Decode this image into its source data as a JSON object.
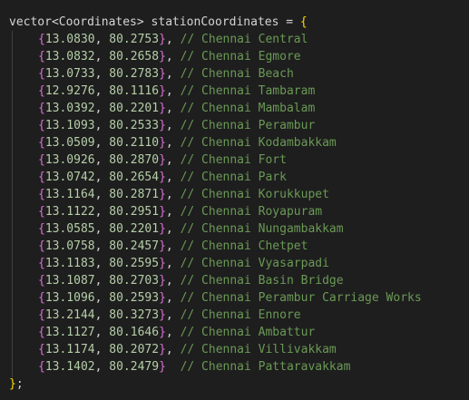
{
  "code": {
    "declaration": {
      "type_text": "vector<Coordinates>",
      "var_text": "stationCoordinates",
      "op_text": " = ",
      "open_brace": "{"
    },
    "entries": [
      {
        "lat": "13.0830",
        "lon": "80.2753",
        "sep": ",",
        "comment": "// Chennai Central"
      },
      {
        "lat": "13.0832",
        "lon": "80.2658",
        "sep": ",",
        "comment": "// Chennai Egmore"
      },
      {
        "lat": "13.0733",
        "lon": "80.2783",
        "sep": ",",
        "comment": "// Chennai Beach"
      },
      {
        "lat": "12.9276",
        "lon": "80.1116",
        "sep": ",",
        "comment": "// Chennai Tambaram"
      },
      {
        "lat": "13.0392",
        "lon": "80.2201",
        "sep": ",",
        "comment": "// Chennai Mambalam"
      },
      {
        "lat": "13.1093",
        "lon": "80.2533",
        "sep": ",",
        "comment": "// Chennai Perambur"
      },
      {
        "lat": "13.0509",
        "lon": "80.2110",
        "sep": ",",
        "comment": "// Chennai Kodambakkam"
      },
      {
        "lat": "13.0926",
        "lon": "80.2870",
        "sep": ",",
        "comment": "// Chennai Fort"
      },
      {
        "lat": "13.0742",
        "lon": "80.2654",
        "sep": ",",
        "comment": "// Chennai Park"
      },
      {
        "lat": "13.1164",
        "lon": "80.2871",
        "sep": ",",
        "comment": "// Chennai Korukkupet"
      },
      {
        "lat": "13.1122",
        "lon": "80.2951",
        "sep": ",",
        "comment": "// Chennai Royapuram"
      },
      {
        "lat": "13.0585",
        "lon": "80.2201",
        "sep": ",",
        "comment": "// Chennai Nungambakkam"
      },
      {
        "lat": "13.0758",
        "lon": "80.2457",
        "sep": ",",
        "comment": "// Chennai Chetpet"
      },
      {
        "lat": "13.1183",
        "lon": "80.2595",
        "sep": ",",
        "comment": "// Chennai Vyasarpadi"
      },
      {
        "lat": "13.1087",
        "lon": "80.2703",
        "sep": ",",
        "comment": "// Chennai Basin Bridge"
      },
      {
        "lat": "13.1096",
        "lon": "80.2593",
        "sep": ",",
        "comment": "// Chennai Perambur Carriage Works"
      },
      {
        "lat": "13.2144",
        "lon": "80.3273",
        "sep": ",",
        "comment": "// Chennai Ennore"
      },
      {
        "lat": "13.1127",
        "lon": "80.1646",
        "sep": ",",
        "comment": "// Chennai Ambattur"
      },
      {
        "lat": "13.1174",
        "lon": "80.2072",
        "sep": ",",
        "comment": "// Chennai Villivakkam"
      },
      {
        "lat": "13.1402",
        "lon": "80.2479",
        "sep": " ",
        "comment": "// Chennai Pattaravakkam"
      }
    ],
    "closing": "}",
    "terminator": ";"
  },
  "colors": {
    "background": "#1e1e1e",
    "text": "#d4d4d4",
    "number": "#b5cea8",
    "comment": "#6a9955",
    "outer_brace": "#ffd700",
    "inner_brace": "#da70d6"
  }
}
